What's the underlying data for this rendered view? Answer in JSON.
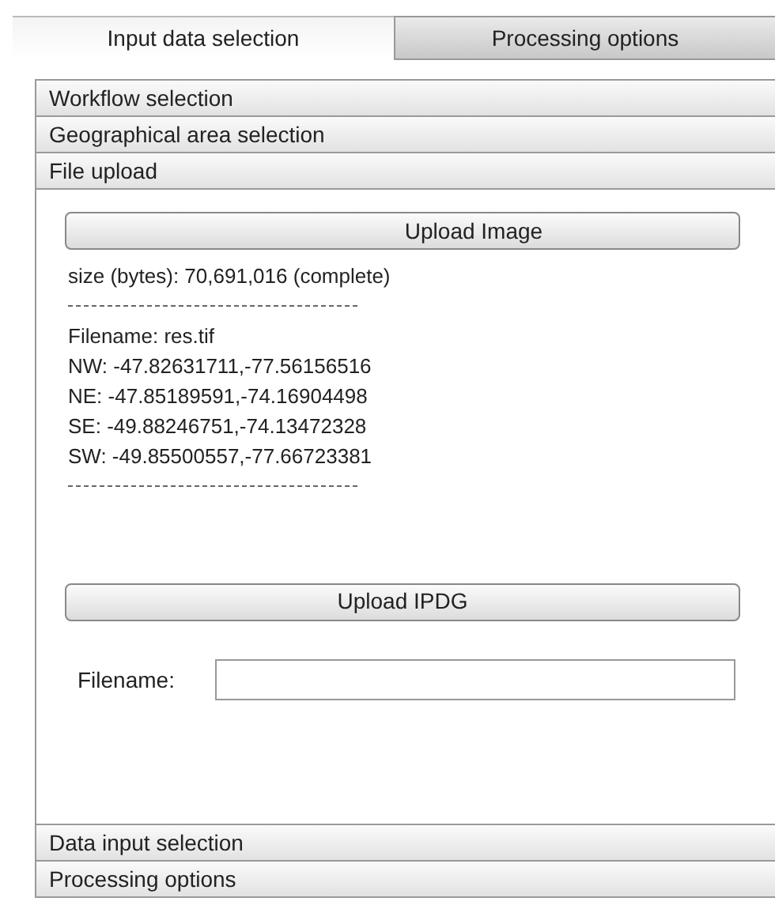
{
  "tabs": [
    {
      "label": "Input data selection",
      "selected": true
    },
    {
      "label": "Processing options",
      "selected": false
    }
  ],
  "sections": [
    {
      "title": "Workflow selection"
    },
    {
      "title": "Geographical area selection"
    },
    {
      "title": "File upload",
      "content": {
        "upload_image_button": "Upload Image",
        "size_text": "size (bytes): 70,691,016 (complete)",
        "info_lines": [
          "Filename: res.tif",
          "NW: -47.82631711,-77.56156516",
          "NE: -47.85189591,-74.16904498",
          "SE: -49.88246751,-74.13472328",
          "SW: -49.85500557,-77.66723381"
        ],
        "upload_ipdg_button": "Upload IPDG",
        "filename_label": "Filename:"
      }
    },
    {
      "title": "Data input selection"
    },
    {
      "title": "Processing options"
    }
  ]
}
